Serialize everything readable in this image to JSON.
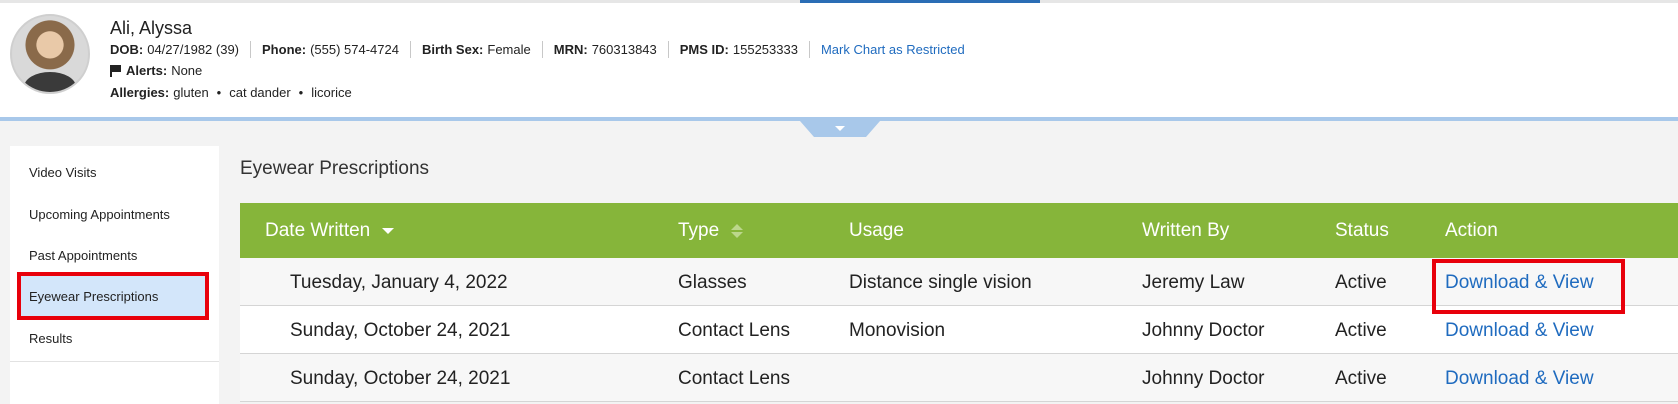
{
  "patient": {
    "name": "Ali, Alyssa",
    "demographics": [
      {
        "label": "DOB:",
        "value": "04/27/1982 (39)"
      },
      {
        "label": "Phone:",
        "value": "(555) 574-4724"
      },
      {
        "label": "Birth Sex:",
        "value": "Female"
      },
      {
        "label": "MRN:",
        "value": "760313843"
      },
      {
        "label": "PMS ID:",
        "value": "155253333"
      }
    ],
    "restrict_link": "Mark Chart as Restricted",
    "alerts_label": "Alerts:",
    "alerts_value": "None",
    "allergies_label": "Allergies:",
    "allergies": [
      "gluten",
      "cat dander",
      "licorice"
    ],
    "allergy_separator": "•"
  },
  "sidebar": {
    "items": [
      {
        "label": "Video Visits"
      },
      {
        "label": "Upcoming Appointments"
      },
      {
        "label": "Past Appointments"
      },
      {
        "label": "Eyewear Prescriptions",
        "active": true
      },
      {
        "label": "Results"
      }
    ]
  },
  "main": {
    "title": "Eyewear Prescriptions",
    "columns": [
      "Date Written",
      "Type",
      "Usage",
      "Written By",
      "Status",
      "Action"
    ],
    "rows": [
      {
        "date": "Tuesday, January 4, 2022",
        "type": "Glasses",
        "usage": "Distance single vision",
        "written_by": "Jeremy Law",
        "status": "Active",
        "action": "Download & View"
      },
      {
        "date": "Sunday, October 24, 2021",
        "type": "Contact Lens",
        "usage": "Monovision",
        "written_by": "Johnny Doctor",
        "status": "Active",
        "action": "Download & View"
      },
      {
        "date": "Sunday, October 24, 2021",
        "type": "Contact Lens",
        "usage": "",
        "written_by": "Johnny Doctor",
        "status": "Active",
        "action": "Download & View"
      }
    ]
  },
  "colors": {
    "header_green": "#86b53a",
    "link_blue": "#1f6bbf",
    "highlight_red": "#e8000b",
    "active_nav": "#d3e6fa"
  },
  "icons": {
    "alerts": "flag-icon",
    "collapse": "chevron-down-icon",
    "sort_desc": "sort-desc-icon",
    "sort_both": "sort-icon"
  }
}
